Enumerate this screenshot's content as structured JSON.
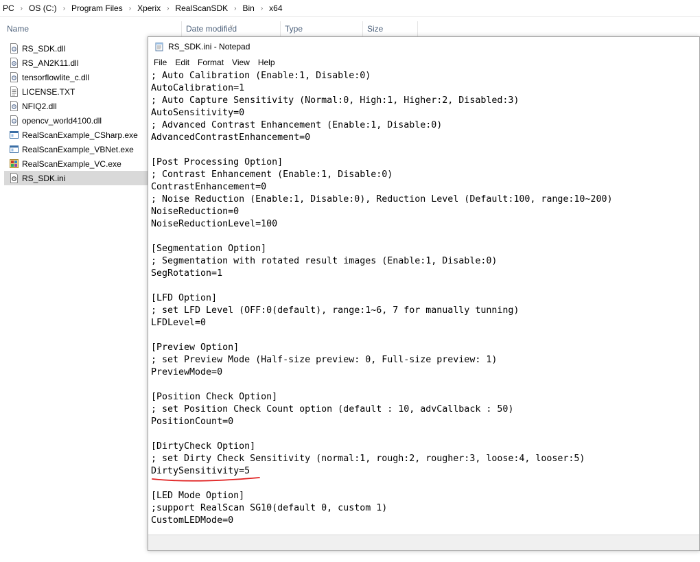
{
  "breadcrumb": [
    "PC",
    "OS (C:)",
    "Program Files",
    "Xperix",
    "RealScanSDK",
    "Bin",
    "x64"
  ],
  "columns": {
    "name": "Name",
    "date_modified": "Date modified",
    "type": "Type",
    "size": "Size"
  },
  "files": [
    {
      "name": "RS_SDK.dll",
      "icon": "dll-file-icon"
    },
    {
      "name": "RS_AN2K11.dll",
      "icon": "dll-file-icon"
    },
    {
      "name": "tensorflowlite_c.dll",
      "icon": "dll-file-icon"
    },
    {
      "name": "LICENSE.TXT",
      "icon": "text-file-icon"
    },
    {
      "name": "NFIQ2.dll",
      "icon": "dll-file-icon"
    },
    {
      "name": "opencv_world4100.dll",
      "icon": "dll-file-icon"
    },
    {
      "name": "RealScanExample_CSharp.exe",
      "icon": "exe-window-icon"
    },
    {
      "name": "RealScanExample_VBNet.exe",
      "icon": "exe-window-icon"
    },
    {
      "name": "RealScanExample_VC.exe",
      "icon": "vc-app-icon"
    },
    {
      "name": "RS_SDK.ini",
      "icon": "ini-settings-icon",
      "selected": true
    }
  ],
  "notepad": {
    "title": "RS_SDK.ini - Notepad",
    "menu": [
      "File",
      "Edit",
      "Format",
      "View",
      "Help"
    ],
    "lines": [
      "; Auto Calibration (Enable:1, Disable:0)",
      "AutoCalibration=1",
      "; Auto Capture Sensitivity (Normal:0, High:1, Higher:2, Disabled:3)",
      "AutoSensitivity=0",
      "; Advanced Contrast Enhancement (Enable:1, Disable:0)",
      "AdvancedContrastEnhancement=0",
      "",
      "[Post Processing Option]",
      "; Contrast Enhancement (Enable:1, Disable:0)",
      "ContrastEnhancement=0",
      "; Noise Reduction (Enable:1, Disable:0), Reduction Level (Default:100, range:10~200)",
      "NoiseReduction=0",
      "NoiseReductionLevel=100",
      "",
      "[Segmentation Option]",
      "; Segmentation with rotated result images (Enable:1, Disable:0)",
      "SegRotation=1",
      "",
      "[LFD Option]",
      "; set LFD Level (OFF:0(default), range:1~6, 7 for manually tunning)",
      "LFDLevel=0",
      "",
      "[Preview Option]",
      "; set Preview Mode (Half-size preview: 0, Full-size preview: 1)",
      "PreviewMode=0",
      "",
      "[Position Check Option]",
      "; set Position Check Count option (default : 10, advCallback : 50)",
      "PositionCount=0",
      "",
      "[DirtyCheck Option]",
      "; set Dirty Check Sensitivity (normal:1, rough:2, rougher:3, loose:4, looser:5)",
      "DirtySensitivity=5",
      "",
      "[LED Mode Option]",
      ";support RealScan SG10(default 0, custom 1)",
      "CustomLEDMode=0"
    ]
  },
  "annotation": {
    "color": "#e02020",
    "target_line": 32
  },
  "colors": {
    "selected_row": "#d9d9d9",
    "header_text": "#4c607a"
  }
}
